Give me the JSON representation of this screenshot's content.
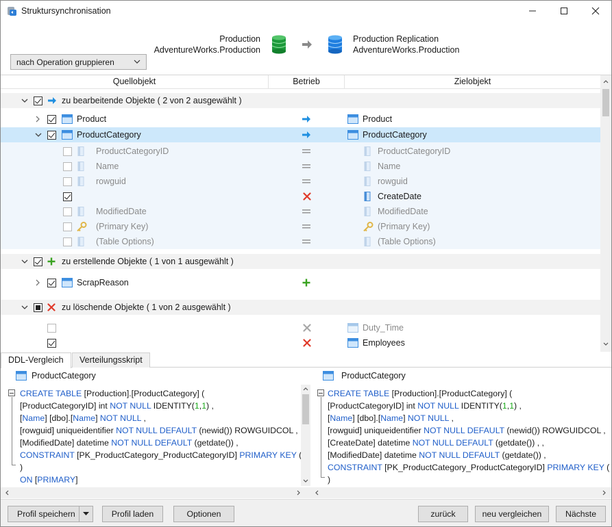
{
  "window": {
    "title": "Struktursynchronisation"
  },
  "header": {
    "source": {
      "line1": "Production",
      "line2": "AdventureWorks.Production"
    },
    "target": {
      "line1": "Production Replication",
      "line2": "AdventureWorks.Production"
    },
    "group_select": "nach Operation gruppieren"
  },
  "grid": {
    "columns": {
      "source": "Quellobjekt",
      "operation": "Betrieb",
      "target": "Zielobjekt"
    },
    "groups": {
      "update": "zu bearbeitende Objekte ( 2 von 2 ausgewählt )",
      "create": "zu erstellende Objekte ( 1 von 1 ausgewählt )",
      "delete": "zu löschende Objekte ( 1 von 2 ausgewählt )"
    },
    "rows": {
      "product_src": "Product",
      "product_dst": "Product",
      "pc_src": "ProductCategory",
      "pc_dst": "ProductCategory",
      "f1_src": "ProductCategoryID",
      "f1_dst": "ProductCategoryID",
      "f2_src": "Name",
      "f2_dst": "Name",
      "f3_src": "rowguid",
      "f3_dst": "rowguid",
      "f4_dst": "CreateDate",
      "f5_src": "ModifiedDate",
      "f5_dst": "ModifiedDate",
      "f6_src": "(Primary Key)",
      "f6_dst": "(Primary Key)",
      "f7_src": "(Table Options)",
      "f7_dst": "(Table Options)",
      "scrap_src": "ScrapReason",
      "duty_dst": "Duty_Time",
      "emp_dst": "Employees"
    }
  },
  "tabs": {
    "ddl": "DDL-Vergleich",
    "script": "Verteilungsskript"
  },
  "ddl": {
    "left_title": "ProductCategory",
    "right_title": "ProductCategory"
  },
  "footer": {
    "save_profile": "Profil speichern",
    "load_profile": "Profil laden",
    "options": "Optionen",
    "back": "zurück",
    "recompare": "neu vergleichen",
    "next": "Nächste"
  },
  "colors": {
    "selection": "#cde8fb",
    "keyword": "#1f5ec9",
    "number": "#1aa81a",
    "add": "#3aa321",
    "delete": "#e03a2a",
    "arrow": "#1f8fe0"
  }
}
